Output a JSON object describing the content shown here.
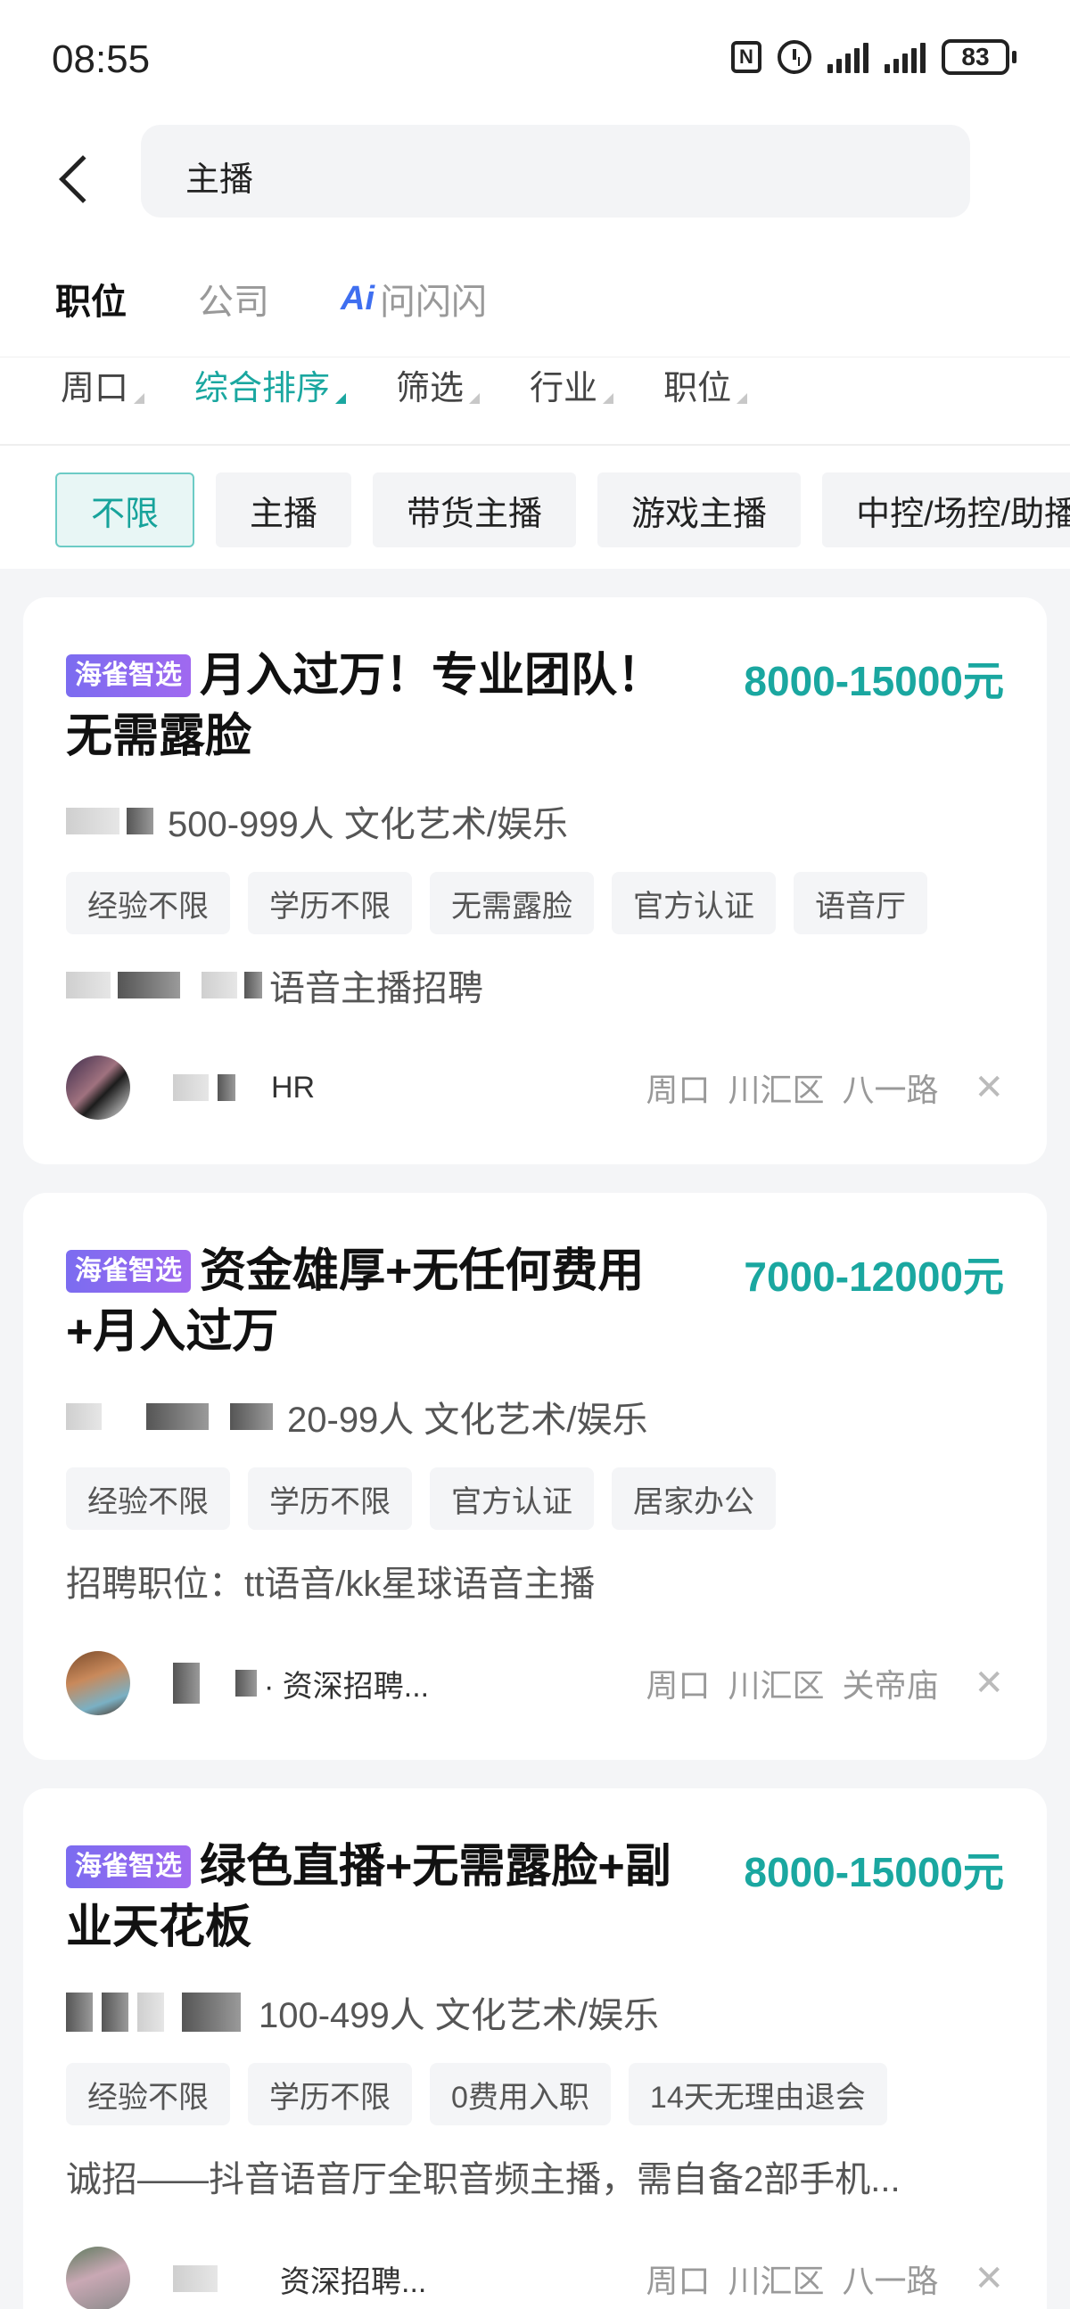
{
  "status": {
    "time": "08:55",
    "battery": "83",
    "nfc": "N"
  },
  "search": {
    "query": "主播"
  },
  "tabs": [
    {
      "label": "职位"
    },
    {
      "label": "公司"
    },
    {
      "label": "问闪闪",
      "badge": "Ai"
    }
  ],
  "filters": [
    {
      "label": "周口"
    },
    {
      "label": "综合排序"
    },
    {
      "label": "筛选"
    },
    {
      "label": "行业"
    },
    {
      "label": "职位"
    }
  ],
  "chips": [
    {
      "label": "不限"
    },
    {
      "label": "主播"
    },
    {
      "label": "带货主播"
    },
    {
      "label": "游戏主播"
    },
    {
      "label": "中控/场控/助播"
    }
  ],
  "jobs": [
    {
      "badge": "海雀智选",
      "title": "月入过万！专业团队！无需露脸",
      "salary": "8000-15000元",
      "company_meta": "500-999人  文化艺术/娱乐",
      "tags": [
        "经验不限",
        "学历不限",
        "无需露脸",
        "官方认证",
        "语音厅"
      ],
      "desc": "语音主播招聘",
      "recruiter": "HR",
      "location": [
        "周口",
        "川汇区",
        "八一路"
      ]
    },
    {
      "badge": "海雀智选",
      "title": "资金雄厚+无任何费用+月入过万",
      "salary": "7000-12000元",
      "company_meta": "20-99人  文化艺术/娱乐",
      "tags": [
        "经验不限",
        "学历不限",
        "官方认证",
        "居家办公"
      ],
      "desc": "招聘职位：tt语音/kk星球语音主播",
      "recruiter": "· 资深招聘...",
      "location": [
        "周口",
        "川汇区",
        "关帝庙"
      ]
    },
    {
      "badge": "海雀智选",
      "title": "绿色直播+无需露脸+副业天花板",
      "salary": "8000-15000元",
      "company_meta": "100-499人  文化艺术/娱乐",
      "tags": [
        "经验不限",
        "学历不限",
        "0费用入职",
        "14天无理由退会"
      ],
      "desc": "诚招——抖音语音厅全职音频主播，需自备2部手机...",
      "recruiter": "资深招聘...",
      "location": [
        "周口",
        "川汇区",
        "八一路"
      ]
    }
  ],
  "colors": {
    "accent": "#1aa7a0",
    "badge": "#8a6cf0",
    "ai": "#3f6ff0"
  }
}
